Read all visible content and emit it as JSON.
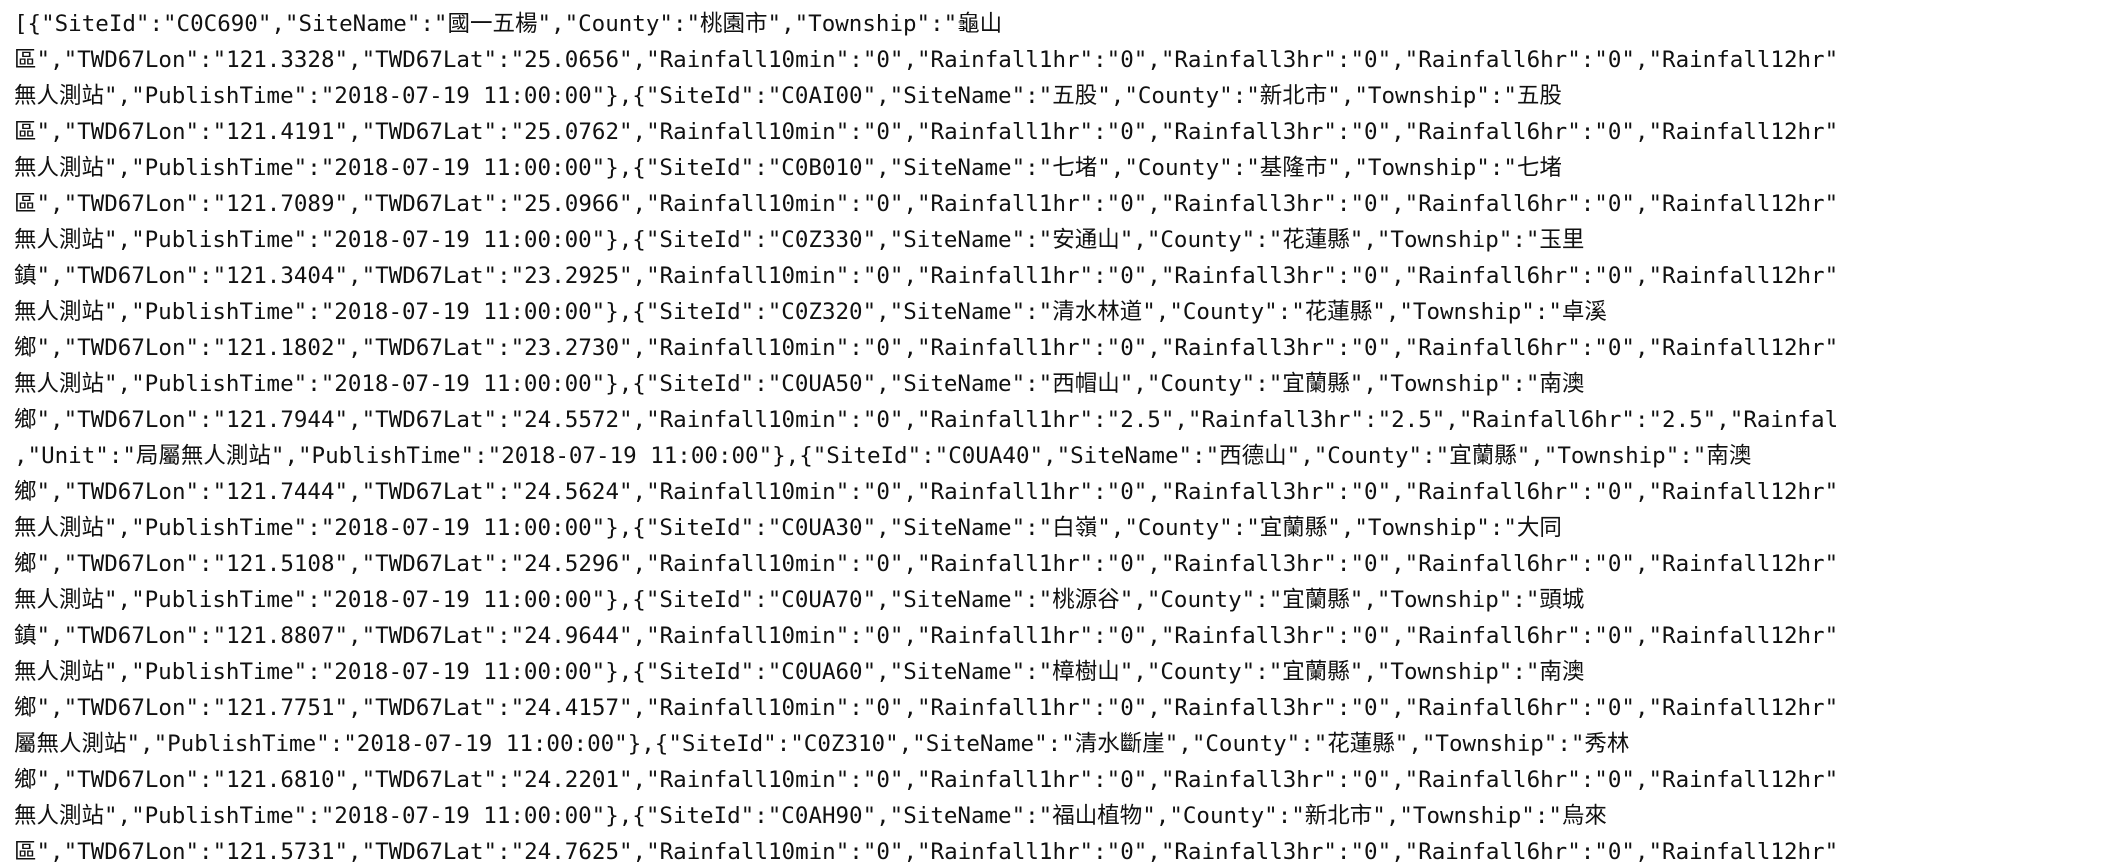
{
  "document": {
    "lines": [
      "[{\"SiteId\":\"C0C690\",\"SiteName\":\"國一五楊\",\"County\":\"桃園市\",\"Township\":\"龜山",
      "區\",\"TWD67Lon\":\"121.3328\",\"TWD67Lat\":\"25.0656\",\"Rainfall10min\":\"0\",\"Rainfall1hr\":\"0\",\"Rainfall3hr\":\"0\",\"Rainfall6hr\":\"0\",\"Rainfall12hr\"",
      "無人測站\",\"PublishTime\":\"2018-07-19 11:00:00\"},{\"SiteId\":\"C0AI00\",\"SiteName\":\"五股\",\"County\":\"新北市\",\"Township\":\"五股",
      "區\",\"TWD67Lon\":\"121.4191\",\"TWD67Lat\":\"25.0762\",\"Rainfall10min\":\"0\",\"Rainfall1hr\":\"0\",\"Rainfall3hr\":\"0\",\"Rainfall6hr\":\"0\",\"Rainfall12hr\"",
      "無人測站\",\"PublishTime\":\"2018-07-19 11:00:00\"},{\"SiteId\":\"C0B010\",\"SiteName\":\"七堵\",\"County\":\"基隆市\",\"Township\":\"七堵",
      "區\",\"TWD67Lon\":\"121.7089\",\"TWD67Lat\":\"25.0966\",\"Rainfall10min\":\"0\",\"Rainfall1hr\":\"0\",\"Rainfall3hr\":\"0\",\"Rainfall6hr\":\"0\",\"Rainfall12hr\"",
      "無人測站\",\"PublishTime\":\"2018-07-19 11:00:00\"},{\"SiteId\":\"C0Z330\",\"SiteName\":\"安通山\",\"County\":\"花蓮縣\",\"Township\":\"玉里",
      "鎮\",\"TWD67Lon\":\"121.3404\",\"TWD67Lat\":\"23.2925\",\"Rainfall10min\":\"0\",\"Rainfall1hr\":\"0\",\"Rainfall3hr\":\"0\",\"Rainfall6hr\":\"0\",\"Rainfall12hr\"",
      "無人測站\",\"PublishTime\":\"2018-07-19 11:00:00\"},{\"SiteId\":\"C0Z320\",\"SiteName\":\"清水林道\",\"County\":\"花蓮縣\",\"Township\":\"卓溪",
      "鄉\",\"TWD67Lon\":\"121.1802\",\"TWD67Lat\":\"23.2730\",\"Rainfall10min\":\"0\",\"Rainfall1hr\":\"0\",\"Rainfall3hr\":\"0\",\"Rainfall6hr\":\"0\",\"Rainfall12hr\"",
      "無人測站\",\"PublishTime\":\"2018-07-19 11:00:00\"},{\"SiteId\":\"C0UA50\",\"SiteName\":\"西帽山\",\"County\":\"宜蘭縣\",\"Township\":\"南澳",
      "鄉\",\"TWD67Lon\":\"121.7944\",\"TWD67Lat\":\"24.5572\",\"Rainfall10min\":\"0\",\"Rainfall1hr\":\"2.5\",\"Rainfall3hr\":\"2.5\",\"Rainfall6hr\":\"2.5\",\"Rainfal",
      ",\"Unit\":\"局屬無人測站\",\"PublishTime\":\"2018-07-19 11:00:00\"},{\"SiteId\":\"C0UA40\",\"SiteName\":\"西德山\",\"County\":\"宜蘭縣\",\"Township\":\"南澳",
      "鄉\",\"TWD67Lon\":\"121.7444\",\"TWD67Lat\":\"24.5624\",\"Rainfall10min\":\"0\",\"Rainfall1hr\":\"0\",\"Rainfall3hr\":\"0\",\"Rainfall6hr\":\"0\",\"Rainfall12hr\"",
      "無人測站\",\"PublishTime\":\"2018-07-19 11:00:00\"},{\"SiteId\":\"C0UA30\",\"SiteName\":\"白嶺\",\"County\":\"宜蘭縣\",\"Township\":\"大同",
      "鄉\",\"TWD67Lon\":\"121.5108\",\"TWD67Lat\":\"24.5296\",\"Rainfall10min\":\"0\",\"Rainfall1hr\":\"0\",\"Rainfall3hr\":\"0\",\"Rainfall6hr\":\"0\",\"Rainfall12hr\"",
      "無人測站\",\"PublishTime\":\"2018-07-19 11:00:00\"},{\"SiteId\":\"C0UA70\",\"SiteName\":\"桃源谷\",\"County\":\"宜蘭縣\",\"Township\":\"頭城",
      "鎮\",\"TWD67Lon\":\"121.8807\",\"TWD67Lat\":\"24.9644\",\"Rainfall10min\":\"0\",\"Rainfall1hr\":\"0\",\"Rainfall3hr\":\"0\",\"Rainfall6hr\":\"0\",\"Rainfall12hr\"",
      "無人測站\",\"PublishTime\":\"2018-07-19 11:00:00\"},{\"SiteId\":\"C0UA60\",\"SiteName\":\"樟樹山\",\"County\":\"宜蘭縣\",\"Township\":\"南澳",
      "鄉\",\"TWD67Lon\":\"121.7751\",\"TWD67Lat\":\"24.4157\",\"Rainfall10min\":\"0\",\"Rainfall1hr\":\"0\",\"Rainfall3hr\":\"0\",\"Rainfall6hr\":\"0\",\"Rainfall12hr\"",
      "屬無人測站\",\"PublishTime\":\"2018-07-19 11:00:00\"},{\"SiteId\":\"C0Z310\",\"SiteName\":\"清水斷崖\",\"County\":\"花蓮縣\",\"Township\":\"秀林",
      "鄉\",\"TWD67Lon\":\"121.6810\",\"TWD67Lat\":\"24.2201\",\"Rainfall10min\":\"0\",\"Rainfall1hr\":\"0\",\"Rainfall3hr\":\"0\",\"Rainfall6hr\":\"0\",\"Rainfall12hr\"",
      "無人測站\",\"PublishTime\":\"2018-07-19 11:00:00\"},{\"SiteId\":\"C0AH90\",\"SiteName\":\"福山植物\",\"County\":\"新北市\",\"Township\":\"烏來",
      "區\",\"TWD67Lon\":\"121.5731\",\"TWD67Lat\":\"24.7625\",\"Rainfall10min\":\"0\",\"Rainfall1hr\":\"0\",\"Rainfall3hr\":\"0\",\"Rainfall6hr\":\"0\",\"Rainfall12hr\""
    ]
  }
}
